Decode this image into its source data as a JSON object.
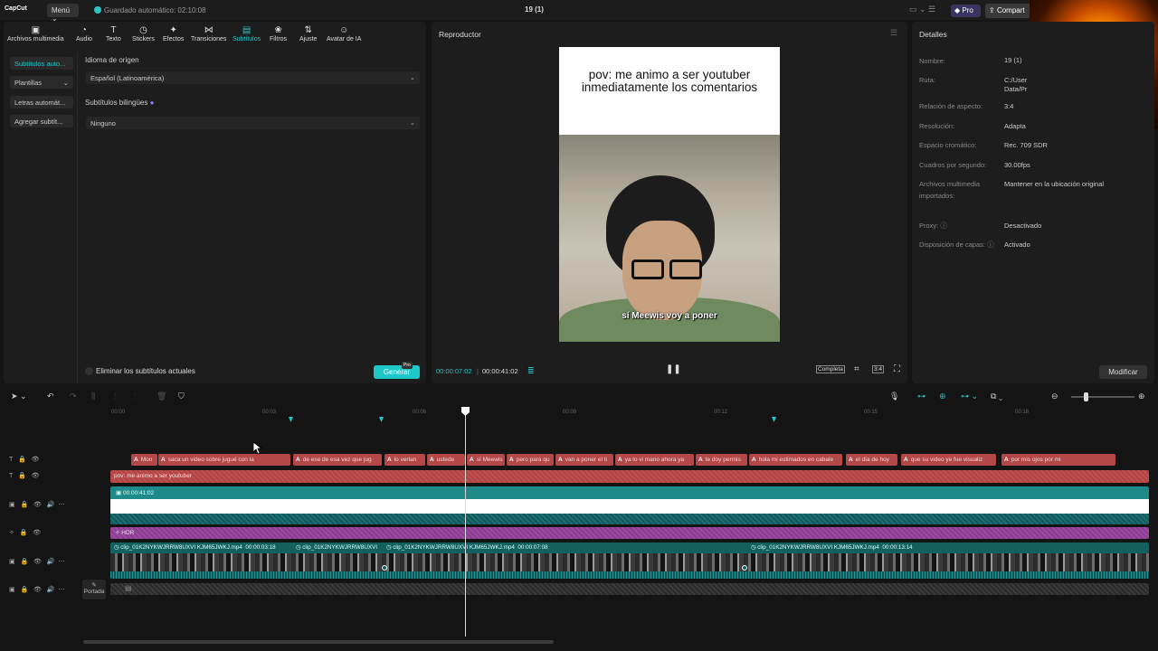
{
  "app": {
    "logo": "CapCut",
    "menu_label": "Menú",
    "autosave": "Guardado automático: 02:10:08",
    "project_title": "19 (1)",
    "pro_label": "Pro",
    "share_label": "Compart"
  },
  "toolbar": {
    "items": [
      {
        "label": "Archivos multimedia",
        "icon": "media-icon"
      },
      {
        "label": "Audio",
        "icon": "audio-icon"
      },
      {
        "label": "Texto",
        "icon": "text-icon"
      },
      {
        "label": "Stickers",
        "icon": "sticker-icon"
      },
      {
        "label": "Efectos",
        "icon": "effects-icon"
      },
      {
        "label": "Transiciones",
        "icon": "transitions-icon"
      },
      {
        "label": "Subtítulos",
        "icon": "subtitles-icon",
        "active": true
      },
      {
        "label": "Filtros",
        "icon": "filters-icon"
      },
      {
        "label": "Ajuste",
        "icon": "adjust-icon"
      },
      {
        "label": "Avatar de IA",
        "icon": "ai-avatar-icon"
      }
    ]
  },
  "subtabs": [
    "Subtítulos auto...",
    "Plantillas",
    "Letras automát...",
    "Agregar subtít..."
  ],
  "captions_panel": {
    "source_label": "Idioma de origen",
    "source_value": "Español (Latinoamérica)",
    "bilingual_label": "Subtítulos bilingües",
    "bilingual_value": "Ninguno",
    "remove_label": "Eliminar los subtítulos actuales",
    "generate_label": "Generar",
    "generate_badge": "Pro"
  },
  "player": {
    "title": "Reproductor",
    "caption": "pov: me animo a ser youtuber inmediatamente los comentarios",
    "subtitle": "sí Meewis voy a poner",
    "current_time": "00:00:07:02",
    "duration": "00:00:41:02",
    "full_label": "Completa",
    "ratio_label": "3:4"
  },
  "details": {
    "title": "Detalles",
    "rows": [
      {
        "key": "Nombre:",
        "value": "19 (1)"
      },
      {
        "key": "Ruta:",
        "value": "C:/User Data/Pr"
      },
      {
        "key": "Relación de aspecto:",
        "value": "3:4"
      },
      {
        "key": "Resolución:",
        "value": "Adapta"
      },
      {
        "key": "Espacio cromático:",
        "value": "Rec. 709 SDR"
      },
      {
        "key": "Cuadros por segundo:",
        "value": "30.00fps"
      },
      {
        "key": "Archivos multimedia importados:",
        "value": "Mantener en la ubicación original"
      },
      {
        "key": "Proxy:",
        "value": "Desactivado"
      },
      {
        "key": "Disposición de capas:",
        "value": "Activado"
      }
    ],
    "modify_label": "Modificar"
  },
  "timeline": {
    "ticks": [
      "00:00",
      "00:03",
      "00:06",
      "00:09",
      "00:12",
      "00:15",
      "00:18"
    ],
    "subtitle_clips": [
      "Mon",
      "saca un video sobre jugué con la",
      "de ese de esa vez que jug",
      "lo verlan",
      "ustede",
      "sí Meewis",
      "pero para qu",
      "van a poner el ti",
      "ya lo vi mano ahora ya",
      "te doy permis",
      "hola mi estimados en cabale",
      "el día de hoy",
      "que su video ye fue visualiz",
      "por mis ojos por mi"
    ],
    "text_track": "pov: me animo a ser youtuber",
    "white_clip_time": "00:00:41:02",
    "hdr_label": "HDR",
    "video_clips": [
      {
        "name": "clip_01K2NYKWJRRW8UXVI KJM65JWKJ.mp4",
        "time": "00:00:03:18"
      },
      {
        "name": "clip_01K2NYKWJRRW8UXVI",
        "time": ""
      },
      {
        "name": "clip_01K2NYKWJRRW8UXVI KJM65JWKJ.mp4",
        "time": "00:00:07:08"
      },
      {
        "name": "clip_01K2NYKWJRRW8UXVI KJM65JWKJ.mp4",
        "time": "00:00:13:14"
      }
    ],
    "cover_label": "Portada"
  }
}
